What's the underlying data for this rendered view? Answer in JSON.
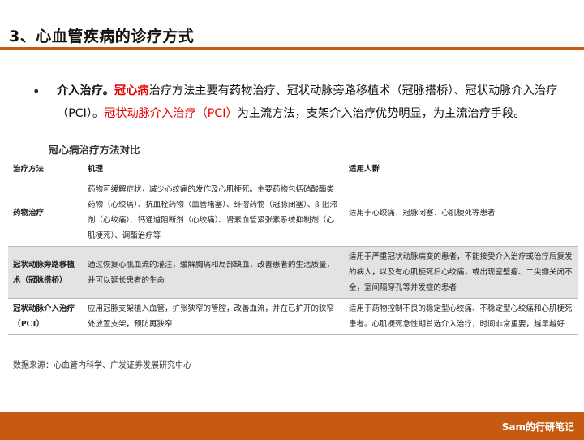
{
  "header": {
    "title": "3、心血管疾病的诊疗方式"
  },
  "bullet": {
    "lead": "介入治疗。",
    "red1": "冠心病",
    "text1": "治疗方法主要有药物治疗、冠状动脉旁路移植术（冠脉搭桥）、冠状动脉介入治疗（PCI）。",
    "red2": "冠状动脉介入治疗（PCI）",
    "text2": "为主流方法，支架介入治疗优势明显，为主流治疗手段。"
  },
  "table": {
    "title": "冠心病治疗方法对比",
    "headers": [
      "治疗方法",
      "机理",
      "适用人群"
    ],
    "rows": [
      {
        "method": "药物治疗",
        "mechanism": "药物可缓解症状，减少心绞痛的发作及心肌梗死。主要药物包括硝酸酯类药物（心绞痛）、抗血栓药物（血管堵塞）、纤溶药物（冠脉闭塞）、β-阻滞剂（心绞痛）、钙通道阻断剂（心绞痛）、肾素血管紧张素系统抑制剂（心肌梗死）、调酯治疗等",
        "population": "适用于心绞痛、冠脉闭塞、心肌梗死等患者"
      },
      {
        "method": "冠状动脉旁路移植术（冠脉搭桥）",
        "mechanism": "通过恢复心肌血流的灌注，缓解胸痛和局部缺血，改善患者的生活质量，并可以延长患者的生命",
        "population": "适用于严重冠状动脉病变的患者，不能接受介入治疗或治疗后复发的病人，以及有心肌梗死后心绞痛，或出现室壁瘤、二尖瓣关闭不全，室间隔穿孔等并发症的患者"
      },
      {
        "method": "冠状动脉介入治疗（PCI）",
        "mechanism": "应用冠脉支架植入血管，扩张狭窄的管腔，改善血流，并在已扩开的狭窄处放置支架，预防再狭窄",
        "population": "适用于药物控制不良的稳定型心绞痛、不稳定型心绞痛和心肌梗死患者。心肌梗死急性期首选介入治疗，时间非常重要，越早越好"
      }
    ]
  },
  "source": "数据来源：心血管内科学、广发证券发展研究中心",
  "footer": {
    "text": "Sam的行研笔记"
  },
  "colors": {
    "accent": "#c65a11",
    "highlight": "#e60000",
    "row_shade": "#e3e3e3"
  }
}
